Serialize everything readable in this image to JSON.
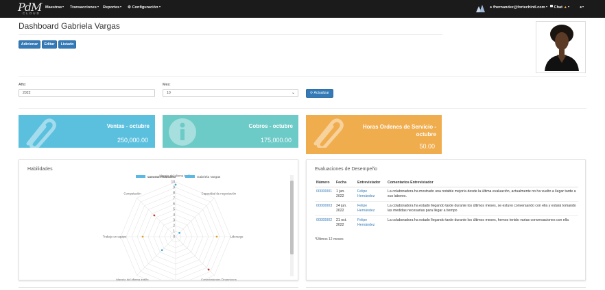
{
  "brand": {
    "logo_text": "PdM",
    "logo_sub": "CLOUD"
  },
  "nav": {
    "items": [
      "Maestras",
      "Transacciones",
      "Reportes",
      "Configuración"
    ],
    "user_email": "fhernandez@fortechintl.com",
    "chat_label": "Chat",
    "help_label": ""
  },
  "page": {
    "title": "Dashboard Gabriela Vargas"
  },
  "toolbar": {
    "add": "Adicionar",
    "edit": "Editar",
    "list": "Listado"
  },
  "filters": {
    "year_label": "Año:",
    "year_value": "2022",
    "month_label": "Mes:",
    "month_value": "10",
    "update_label": "Actualizar"
  },
  "tiles": [
    {
      "title": "Ventas - octubre",
      "value": "250,000.00",
      "color": "#5bc0de"
    },
    {
      "title": "Cobros - octubre",
      "value": "175,000.00",
      "color": "#6ccac7"
    },
    {
      "title_line1": "Horas Ordenes de Servicio -",
      "title_line2": "octubre",
      "value": "50.00",
      "color": "#f0ad4e"
    }
  ],
  "skills": {
    "title": "Habilidades",
    "chart_data": {
      "type": "radar",
      "legend": [
        "Gerente Financiero",
        "Gabriela Vargas"
      ],
      "axes": [
        "Manejo del idioma inglés",
        "Capacidad de negociación",
        "Liderazgo",
        "Conocimientos Financieros",
        "Aritmética",
        "Manejo del idioma inglés",
        "Trabajo en equipo",
        "Computación"
      ],
      "ticks": [
        "0",
        "1",
        "2",
        "3",
        "4",
        "5",
        "6",
        "7",
        "8",
        "9",
        "10"
      ],
      "range": [
        0,
        10
      ]
    }
  },
  "evaluations": {
    "title": "Evaluaciones de Desempeño",
    "columns": [
      "Número",
      "Fecha",
      "Entrevistador",
      "Comentarios Entrevistador"
    ],
    "rows": [
      {
        "num": "00000001",
        "date1": "1 jun.",
        "date2": "2022",
        "int1": "Felipe",
        "int2": "Hernández",
        "comment": "La colaboradora ha mostrado una notable mejoría desde la última evaluación, actualmente no ha vuelto a llegar tarde a sus labores."
      },
      {
        "num": "00000003",
        "date1": "24 jun.",
        "date2": "2022",
        "int1": "Felipe",
        "int2": "Hernández",
        "comment": "La colaboradora ha estado llegando tarde durante los últimos meses, se estuvo conversando con ella y estará tomando las medidas necesarias para llegar a tiempo"
      },
      {
        "num": "00000002",
        "date1": "21 oct.",
        "date2": "2022",
        "int1": "Felipe",
        "int2": "Hernández",
        "comment": "La colaboradora ha estado llegando tarde durante los últimos meses, hemos tenido varias conversaciones con ella"
      }
    ],
    "footer": "*Últimos 12 meses"
  }
}
